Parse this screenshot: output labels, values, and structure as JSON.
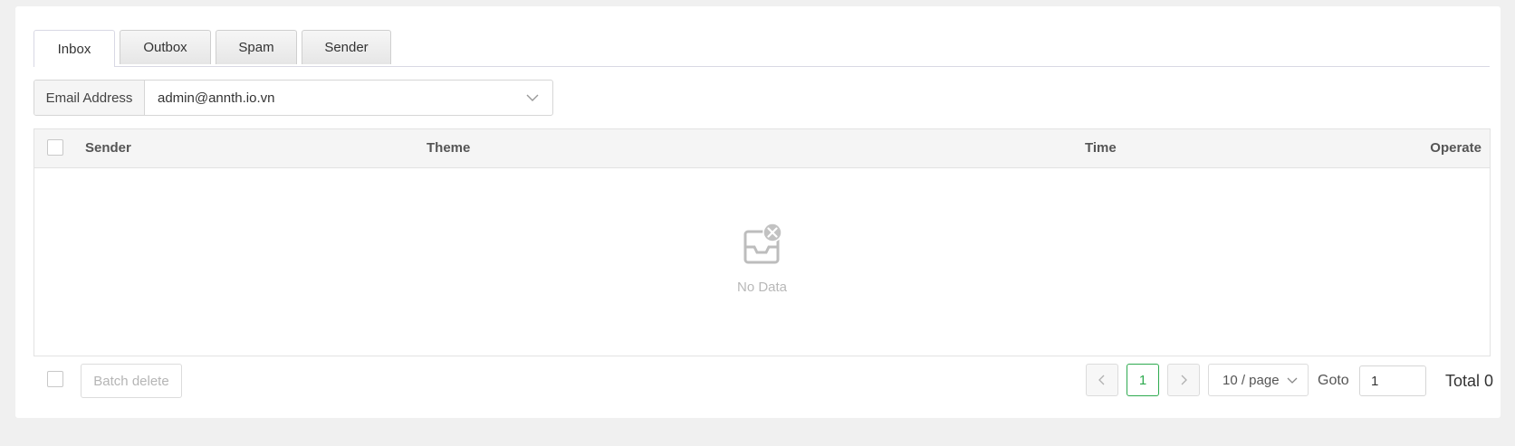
{
  "tabs": [
    {
      "label": "Inbox",
      "active": true
    },
    {
      "label": "Outbox",
      "active": false
    },
    {
      "label": "Spam",
      "active": false
    },
    {
      "label": "Sender",
      "active": false
    }
  ],
  "filter": {
    "label": "Email Address",
    "value": "admin@annth.io.vn"
  },
  "table": {
    "columns": [
      "Sender",
      "Theme",
      "Time",
      "Operate"
    ],
    "rows": [],
    "empty_text": "No Data"
  },
  "footer": {
    "batch_delete_label": "Batch delete",
    "current_page": "1",
    "page_size": "10 / page",
    "goto_label": "Goto",
    "goto_value": "1",
    "total_label": "Total 0"
  },
  "colors": {
    "accent": "#2eaa4f",
    "header_bg": "#f5f5f5",
    "border": "#e2e2e2"
  }
}
